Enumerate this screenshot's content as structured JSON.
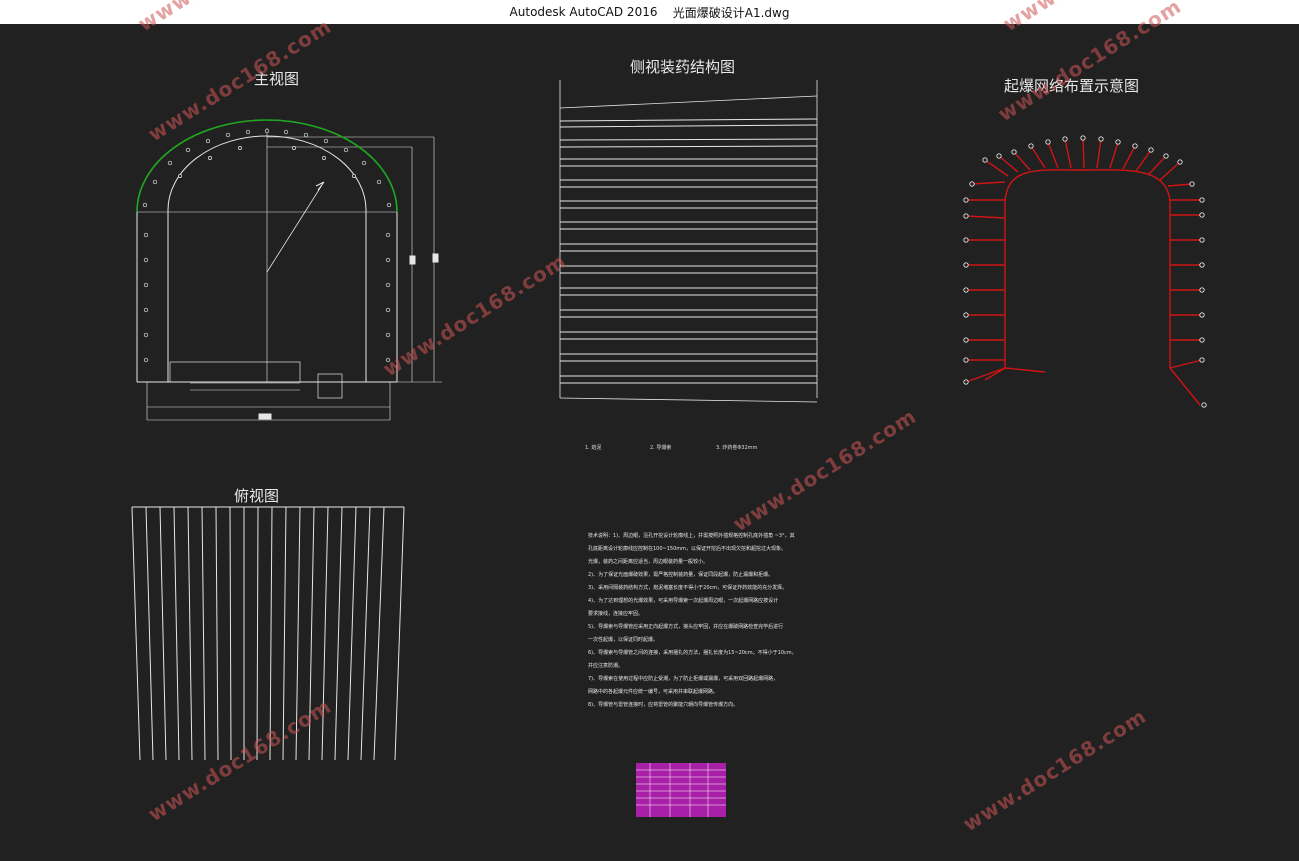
{
  "window": {
    "app_title": "Autodesk AutoCAD 2016",
    "file_name": "光面爆破设计A1.dwg"
  },
  "views": {
    "front_view_title": "主视图",
    "side_view_title": "侧视装药结构图",
    "network_title": "起爆网络布置示意图",
    "top_view_title": "俯视图"
  },
  "side_legend": [
    "1. 炮泥",
    "2. 导爆索",
    "3. 炸药卷Φ32mm"
  ],
  "notes": [
    "技术说明：1)、周边眼，沿孔开挖设计轮廓线上，并需按照外插规格控制孔底外插角 ~3°，其",
    "孔底距离设计轮廓线应控制在100~150mm，以保证开挖后不出现欠挖和超挖过大现象。",
    "光爆，装药之间距离应适当，周边眼装药量一般较小。",
    "2)、为了保证光面爆破效果，需严格控制装药量，保证同段起爆，防止漏爆和拒爆。",
    "3)、采用间隔装药结构方式，炮泥堵塞长度不得小于20cm，可保证炸药效能的充分发挥。",
    "4)、为了达到理想的光爆效果，可采用导爆索一次起爆周边眼，一次起爆网路应按设计",
    "要求接线，连接应牢固。",
    "5)、导爆索与导爆管应采用正向起爆方式，接头应牢固，并应在爆破网路检查完毕后进行",
    "一次性起爆，以保证同时起爆。",
    "6)、导爆索与导爆管之间的连接，采用捆扎的方法，捆扎长度为15~20cm，不得小于10cm，",
    "并应注意防潮。",
    "7)、导爆索在使用过程中应防止受潮，为了防止拒爆或漏爆，可采用双回路起爆网路，",
    "网路中的各起爆元件应统一编号，可采用并串联起爆网路。",
    "8)、导爆管与雷管连接时，应将雷管的聚能穴朝向导爆管传爆方向。"
  ],
  "watermark_text": "www.doc168.com",
  "colors": {
    "background": "#212121",
    "line": "#e6e6e6",
    "green_arc": "#1fa81f",
    "red_network": "#d01414",
    "table_magenta": "#c020c0",
    "watermark": "#cd5555"
  }
}
